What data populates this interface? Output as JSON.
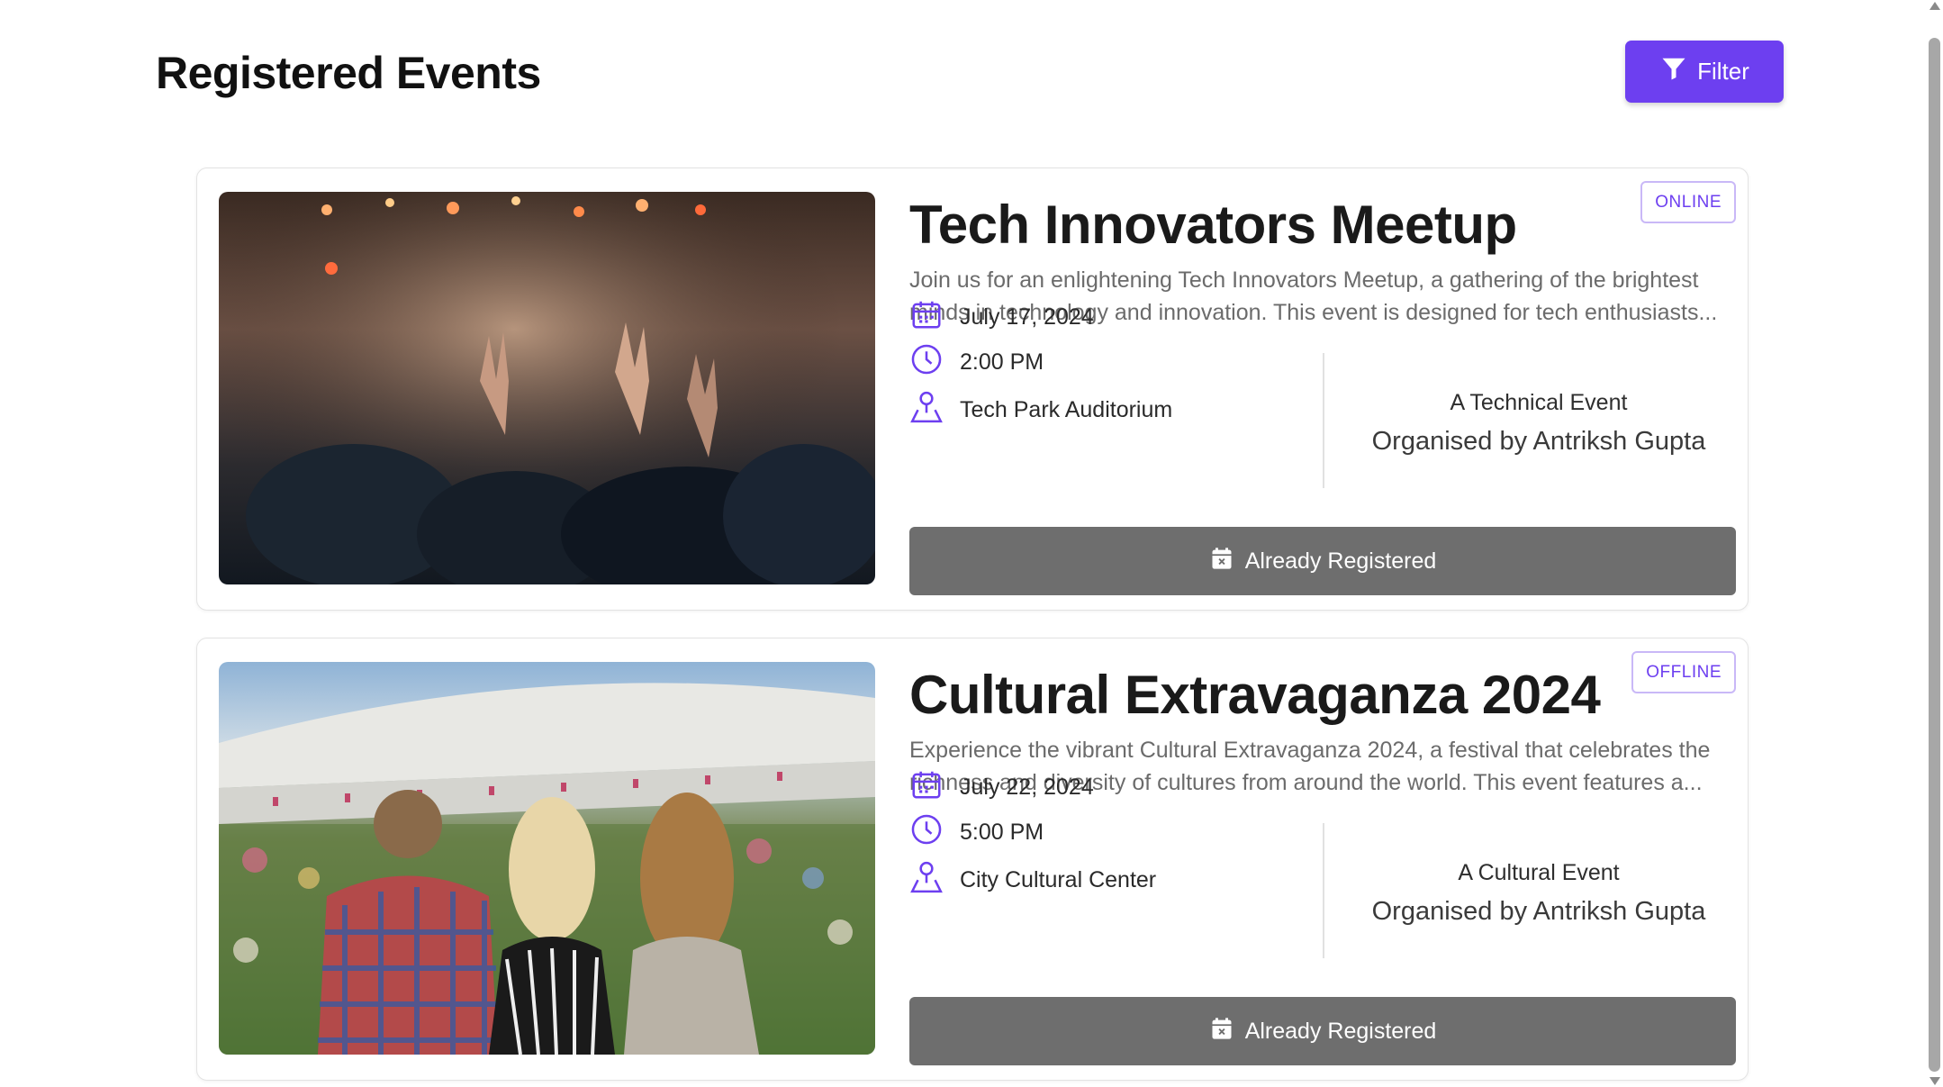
{
  "header": {
    "title": "Registered Events",
    "filter_label": "Filter"
  },
  "events": [
    {
      "title": "Tech Innovators Meetup",
      "mode": "ONLINE",
      "description": "Join us for an enlightening Tech Innovators Meetup, a gathering of the brightest minds in technology and innovation. This event is designed for tech enthusiasts...",
      "date": "July 17, 2024",
      "time": "2:00 PM",
      "venue": "Tech Park Auditorium",
      "category": "A Technical Event",
      "organiser": "Organised by Antriksh Gupta",
      "status_label": "Already Registered"
    },
    {
      "title": "Cultural Extravaganza 2024",
      "mode": "OFFLINE",
      "description": "Experience the vibrant Cultural Extravaganza 2024, a festival that celebrates the richness and diversity of cultures from around the world. This event features a...",
      "date": "July 22, 2024",
      "time": "5:00 PM",
      "venue": "City Cultural Center",
      "category": "A Cultural Event",
      "organiser": "Organised by Antriksh Gupta",
      "status_label": "Already Registered"
    }
  ],
  "colors": {
    "accent": "#6d3ff0",
    "registered_button": "#6e6e6e",
    "badge_border": "#c9b8f7"
  },
  "icons": [
    "filter-icon",
    "calendar-icon",
    "clock-icon",
    "location-icon",
    "calendar-x-icon"
  ]
}
